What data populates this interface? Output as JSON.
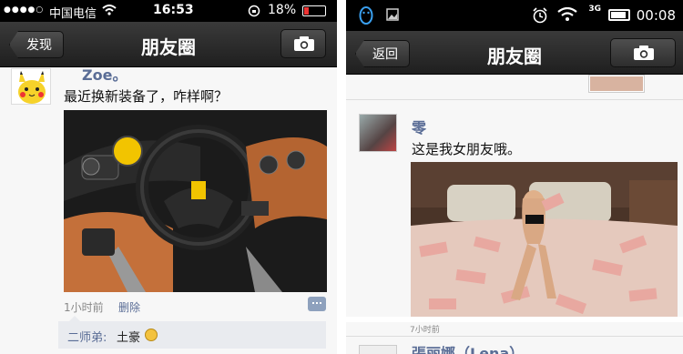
{
  "left": {
    "status": {
      "carrier": "中国电信",
      "time": "16:53",
      "battery": "18%"
    },
    "nav": {
      "back": "发现",
      "title": "朋友圈"
    },
    "post": {
      "name": "Zoe。",
      "text": "最近换新装备了，咋样啊？",
      "time": "1小时前",
      "delete": "删除"
    },
    "comment": {
      "name": "二师弟:",
      "text": "土豪"
    }
  },
  "right": {
    "status": {
      "time": "00:08",
      "network": "3G"
    },
    "nav": {
      "back": "返回",
      "title": "朋友圈"
    },
    "post": {
      "name": "零",
      "text": "这是我女朋友哦。",
      "time": "7小时前"
    },
    "next_post": {
      "name": "張丽娜（Lena）"
    }
  }
}
